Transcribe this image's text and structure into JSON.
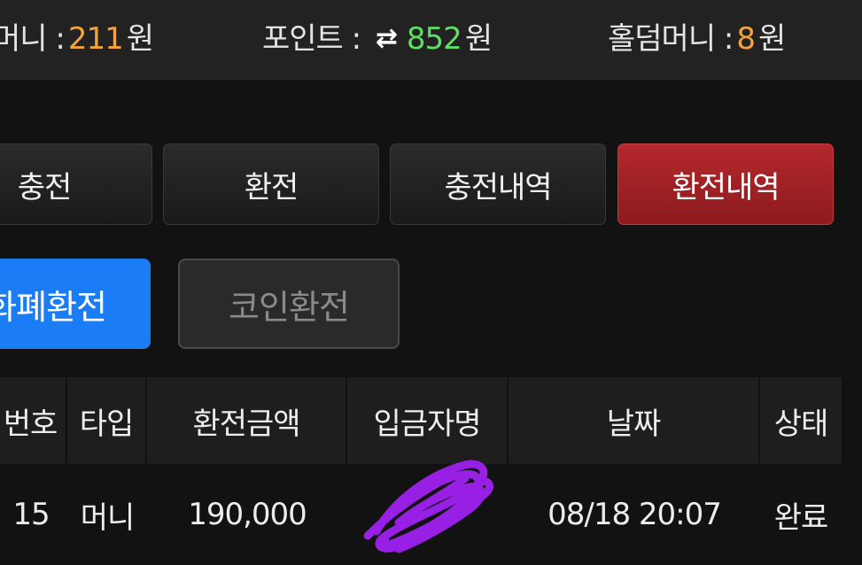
{
  "balances": {
    "money": {
      "label": "머니 :",
      "amount": "211",
      "unit": "원"
    },
    "point": {
      "label": "포인트 :",
      "icon": "swap-arrows-icon",
      "amount": "852",
      "unit": "원"
    },
    "holdem": {
      "label": "홀덤머니 :",
      "amount": "8",
      "unit": "원"
    }
  },
  "tabs": [
    {
      "label": "충전"
    },
    {
      "label": "환전"
    },
    {
      "label": "충전내역"
    },
    {
      "label": "환전내역",
      "active": true
    }
  ],
  "subtabs": [
    {
      "label": "화폐환전",
      "active": true
    },
    {
      "label": "코인환전"
    }
  ],
  "table": {
    "headers": [
      "번호",
      "타입",
      "환전금액",
      "입금자명",
      "날짜",
      "상태"
    ],
    "rows": [
      [
        "15",
        "머니",
        "190,000",
        "",
        "08/18 20:07",
        "완료"
      ]
    ]
  },
  "colors": {
    "active_tab": "#b4282c",
    "active_subtab": "#1a7df5",
    "money_amount": "#f2a33c",
    "point_amount": "#5fdd66",
    "redaction": "#a020f0"
  }
}
